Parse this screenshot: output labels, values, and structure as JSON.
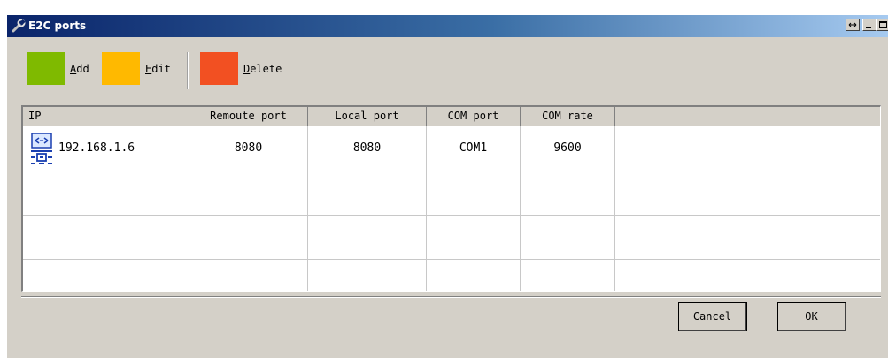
{
  "window": {
    "title": "E2C ports",
    "icon": "wrench-icon",
    "titlebar_buttons": [
      "resize-icon",
      "minimize-icon",
      "maximize-icon",
      "close-icon"
    ]
  },
  "toolbar": {
    "add": {
      "pre": "",
      "accel": "A",
      "post": "dd",
      "color": "#7fba00"
    },
    "edit": {
      "pre": "",
      "accel": "E",
      "post": "dit",
      "color": "#ffb900"
    },
    "delete": {
      "pre": "",
      "accel": "D",
      "post": "elete",
      "color": "#f25022"
    }
  },
  "table": {
    "columns": [
      "IP",
      "Remoute port",
      "Local port",
      "COM port",
      "COM rate"
    ],
    "rows": [
      {
        "icon": "network-device-icon",
        "ip": "192.168.1.6",
        "remote_port": "8080",
        "local_port": "8080",
        "com_port": "COM1",
        "com_rate": "9600"
      }
    ]
  },
  "footer": {
    "cancel": "Cancel",
    "ok": "OK"
  }
}
